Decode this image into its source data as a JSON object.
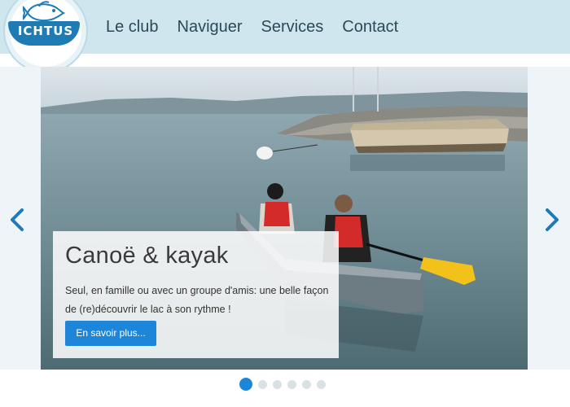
{
  "logo": {
    "text": "ICHTUS"
  },
  "nav": {
    "items": [
      {
        "label": "Le club"
      },
      {
        "label": "Naviguer"
      },
      {
        "label": "Services"
      },
      {
        "label": "Contact"
      }
    ]
  },
  "slide": {
    "title": "Canoë & kayak",
    "text": "Seul, en famille ou avec un groupe d'amis: une belle façon de (re)découvrir le lac à son rythme !",
    "button_label": "En savoir plus..."
  },
  "carousel": {
    "slide_count": 6,
    "active_index": 0
  },
  "colors": {
    "header_bg": "#cfe6ef",
    "accent": "#1e86d8",
    "logo_blue": "#1e7bb4"
  }
}
